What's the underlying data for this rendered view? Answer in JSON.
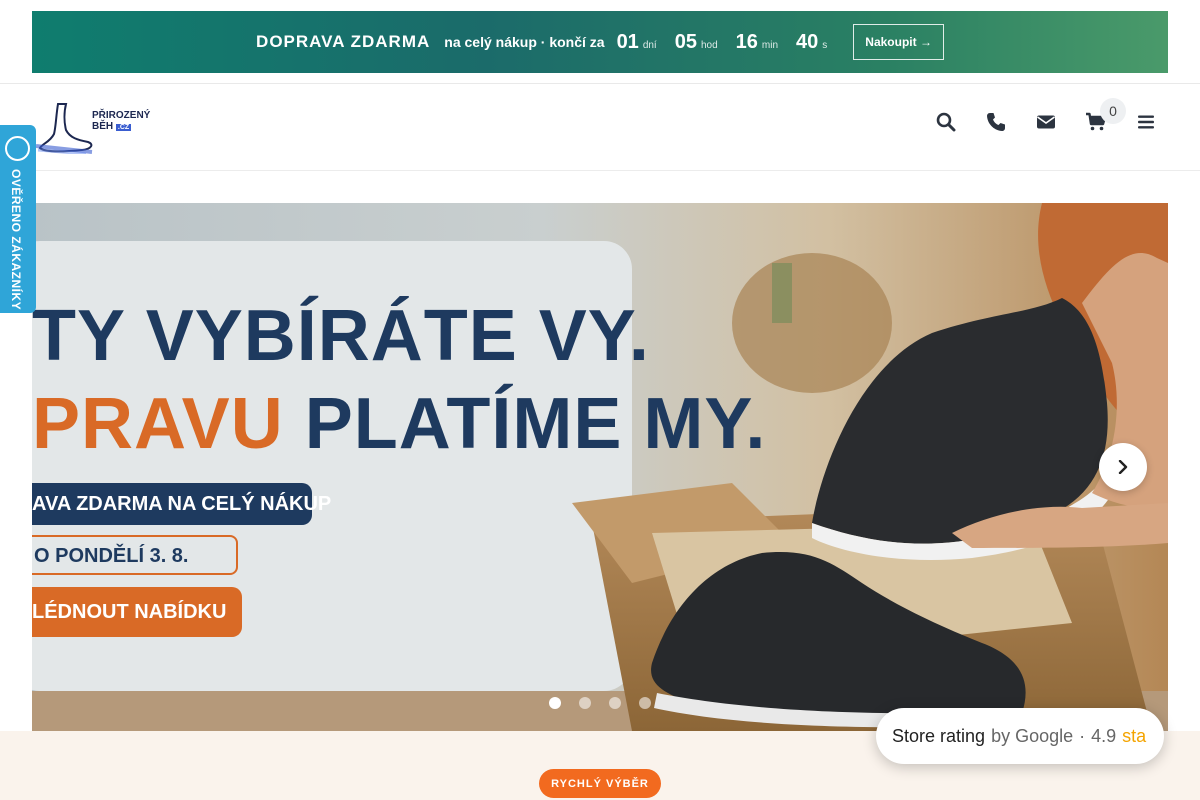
{
  "promo": {
    "title": "DOPRAVA ZDARMA",
    "subtitle": "na celý nákup · končí za",
    "countdown": [
      {
        "value": "01",
        "unit": "dní"
      },
      {
        "value": "05",
        "unit": "hod"
      },
      {
        "value": "16",
        "unit": "min"
      },
      {
        "value": "40",
        "unit": "s"
      }
    ],
    "button_label": "Nakoupit →"
  },
  "header": {
    "logo_line1": "PŘIROZENÝ",
    "logo_line2": "BĚH",
    "logo_tld": ".CZ",
    "cart_count": "0",
    "icons": [
      "search-icon",
      "phone-icon",
      "mail-icon",
      "cart-icon",
      "menu-icon"
    ]
  },
  "verified_tab": {
    "label": "OVĚŘENO ZÁKAZNÍKY"
  },
  "hero": {
    "headline1": "TY VYBÍRÁTE VY.",
    "headline2_accent": "PRAVU",
    "headline2_rest": "PLATÍME MY.",
    "badge1": "AVA ZDARMA NA CELÝ NÁKUP",
    "badge2": "O PONDĚLÍ 3. 8.",
    "badge3": "LÉDNOUT NABÍDKU",
    "slides_total": 4,
    "active_slide": 1
  },
  "quick_select": {
    "label": "RYCHLÝ VÝBĚR"
  },
  "store_rating": {
    "label": "Store rating",
    "by": "by Google",
    "separator": "·",
    "value": "4.9",
    "stars_text": "sta"
  },
  "colors": {
    "promo_bg": "#1b6b6a",
    "accent_orange": "#f26a1f",
    "navy": "#1e3a5f",
    "verified_blue": "#2fa5d8"
  }
}
